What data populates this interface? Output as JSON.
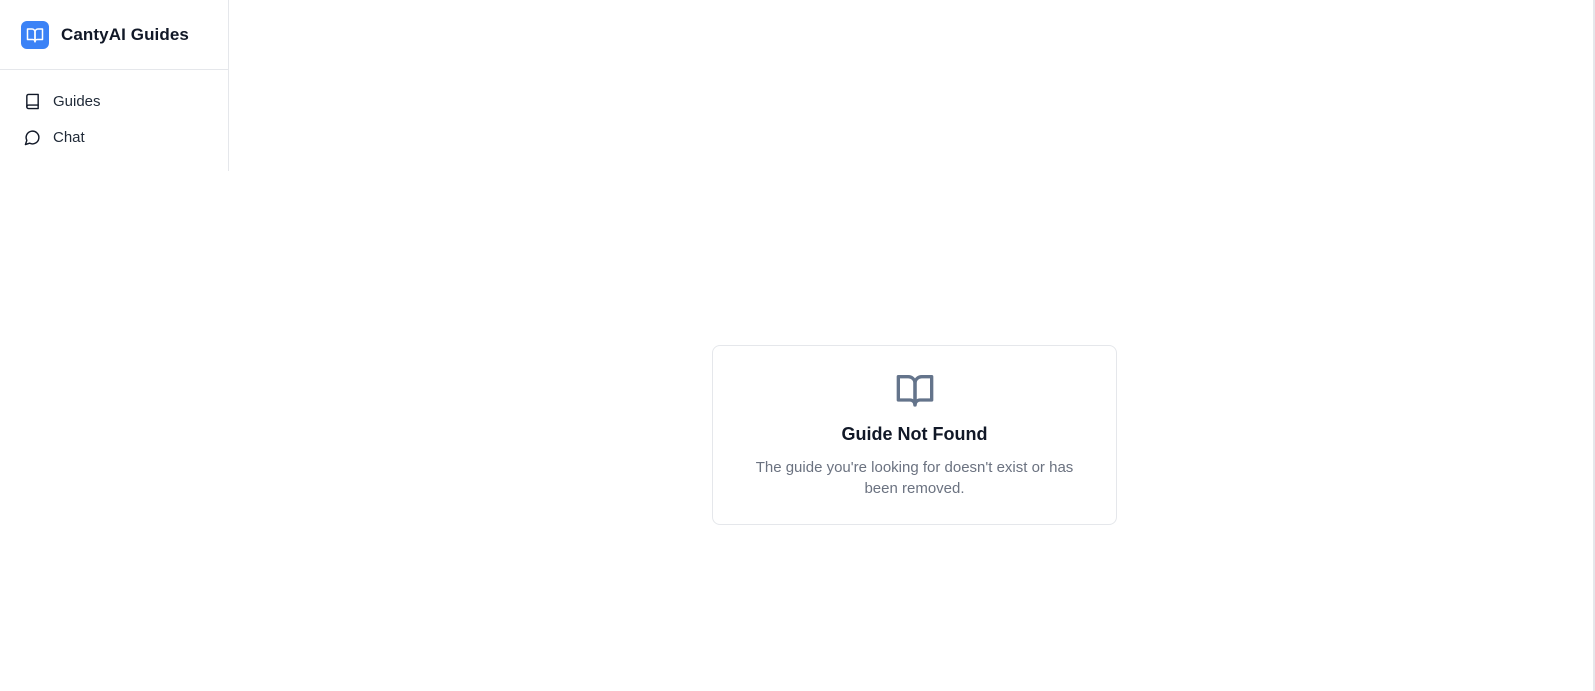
{
  "sidebar": {
    "brand": {
      "title": "CantyAI Guides",
      "icon": "book-open-icon",
      "accent": "#3b82f6"
    },
    "items": [
      {
        "label": "Guides",
        "icon": "book-icon"
      },
      {
        "label": "Chat",
        "icon": "chat-bubble-icon"
      }
    ]
  },
  "empty_state": {
    "icon": "book-open-icon",
    "title": "Guide Not Found",
    "description": "The guide you're looking for doesn't exist or has been removed."
  }
}
